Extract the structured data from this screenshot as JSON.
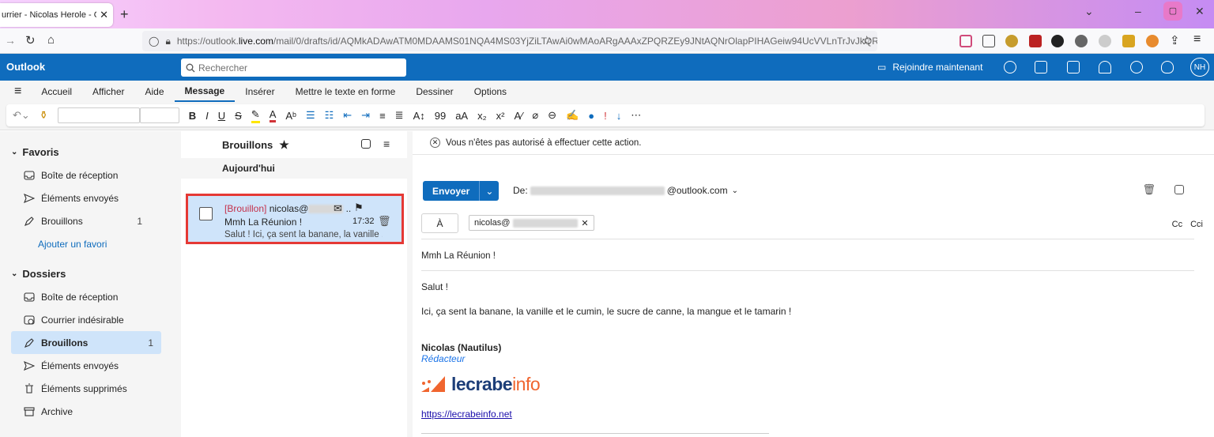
{
  "browser": {
    "tab_title": "urrier - Nicolas Herole - Outl",
    "url_prefix": "https://outlook.",
    "url_domain": "live.com",
    "url_path": "/mail/0/drafts/id/AQMkADAwATM0MDAAMS01NQA4MS03YjZiLTAwAi0wMAoARgAAAxZPQRZEy9JNtAQNrOlapPIHAGeiw94UcVVLnTrJvJkQRMU"
  },
  "app": {
    "brand": "Outlook",
    "search_placeholder": "Rechercher",
    "join_label": "Rejoindre maintenant",
    "avatar_initials": "NH"
  },
  "ribbon_tabs": [
    "Accueil",
    "Afficher",
    "Aide",
    "Message",
    "Insérer",
    "Mettre le texte en forme",
    "Dessiner",
    "Options"
  ],
  "nav": {
    "favorites_label": "Favoris",
    "favorites": [
      {
        "label": "Boîte de réception",
        "count": ""
      },
      {
        "label": "Éléments envoyés",
        "count": ""
      },
      {
        "label": "Brouillons",
        "count": "1"
      }
    ],
    "add_favorite": "Ajouter un favori",
    "folders_label": "Dossiers",
    "folders": [
      {
        "label": "Boîte de réception",
        "count": ""
      },
      {
        "label": "Courrier indésirable",
        "count": ""
      },
      {
        "label": "Brouillons",
        "count": "1"
      },
      {
        "label": "Éléments envoyés",
        "count": ""
      },
      {
        "label": "Éléments supprimés",
        "count": ""
      },
      {
        "label": "Archive",
        "count": ""
      }
    ]
  },
  "list": {
    "title": "Brouillons",
    "group": "Aujourd'hui",
    "message": {
      "draft_tag": "[Brouillon]",
      "recipient": "nicolas@",
      "subject": "Mmh La Réunion !",
      "time": "17:32",
      "preview": "Salut ! Ici, ça sent la banane, la vanille ..."
    }
  },
  "compose": {
    "notice": "Vous n'êtes pas autorisé à effectuer cette action.",
    "send_label": "Envoyer",
    "from_label": "De:",
    "from_domain": "@outlook.com",
    "to_label": "À",
    "to_chip": "nicolas@",
    "cc_label": "Cc",
    "bcc_label": "Cci",
    "subject": "Mmh La Réunion !",
    "greeting": "Salut !",
    "body": "Ici, ça sent la banane, la vanille et le cumin, le sucre de canne, la mangue et le tamarin !",
    "sig_name": "Nicolas (Nautilus)",
    "sig_role": "Rédacteur",
    "logo_main": "lecrabe",
    "logo_accent": "info",
    "sig_link": "https://lecrabeinfo.net"
  },
  "colors": {
    "accent": "#0f6cbd",
    "highlight": "#e53935"
  }
}
